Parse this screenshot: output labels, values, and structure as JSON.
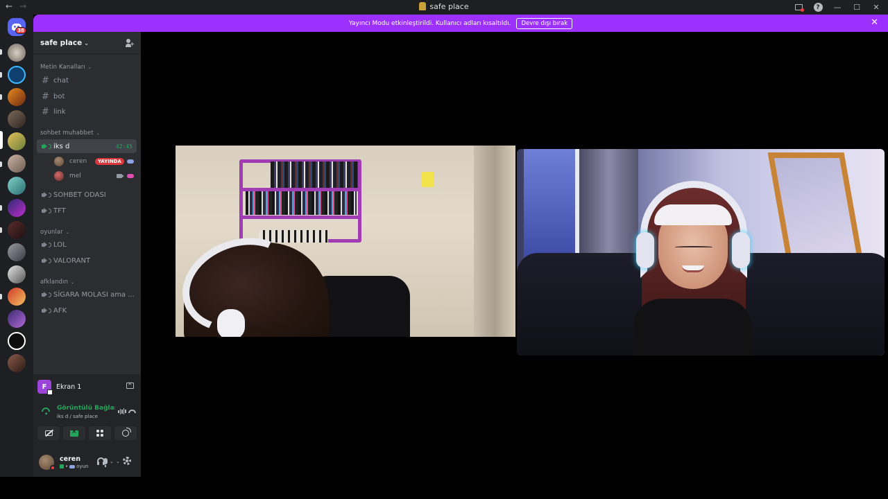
{
  "window": {
    "title": "safe place",
    "back_icon": "arrow-left-icon",
    "forward_icon": "arrow-right-icon",
    "controls": [
      "minimize-icon",
      "maximize-icon",
      "close-icon"
    ]
  },
  "rail": {
    "dm_badge": "38"
  },
  "banner": {
    "text": "Yayıncı Modu etkinleştirildi. Kullanıcı adları kısaltıldı.",
    "button": "Devre dışı bırak",
    "close": "✕",
    "color": "#9b30ff"
  },
  "guild": {
    "name": "safe place",
    "chevron": "⌄"
  },
  "categories": {
    "text": "Metin Kanalları",
    "sohbet": "sohbet muhabbet",
    "oyunlar": "oyunlar",
    "afk": "afklandın"
  },
  "channels": {
    "chat": "chat",
    "bot": "bot",
    "link": "link",
    "iksd": "iks d",
    "iksd_timer": "42:45",
    "sohbet_odasi": "SOHBET ODASI",
    "tft": "TFT",
    "lol": "LOL",
    "valorant": "VALORANT",
    "sigara": "SİGARA MOLASI ama ...",
    "afk": "AFK"
  },
  "voice_users": [
    {
      "name": "ceren",
      "badge": "YAYINDA"
    },
    {
      "name": "mel"
    }
  ],
  "panel": {
    "screen_initial": "F",
    "screen_label": "Ekran 1",
    "vc_status": "Görüntülü Bağlantı Kuruldu",
    "vc_sub": "iks d / safe place",
    "user_name": "ceren",
    "user_activity": "oyun"
  },
  "colors": {
    "accent_green": "#23a55a",
    "live_red": "#da373c",
    "sidebar_bg": "#2b2d31",
    "rail_bg": "#1e1f22"
  }
}
